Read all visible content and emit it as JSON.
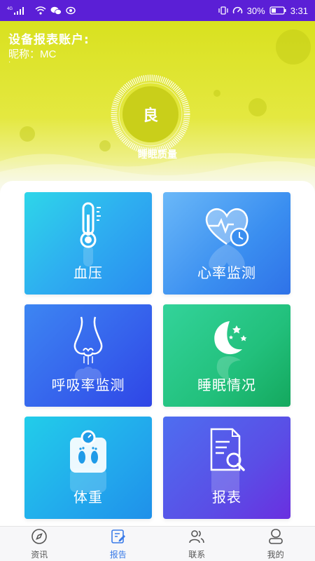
{
  "status_bar": {
    "network": "4G",
    "battery": "30%",
    "time": "3:31"
  },
  "header": {
    "account_title": "设备报表账户:",
    "nickname_label": "昵称：",
    "nickname_value": "MC",
    "dot": "·",
    "quality_value": "良",
    "quality_label": "睡眠质量"
  },
  "tiles": [
    {
      "label": "血压",
      "icon": "thermometer-icon"
    },
    {
      "label": "心率监测",
      "icon": "heart-rate-icon"
    },
    {
      "label": "呼吸率监测",
      "icon": "nose-icon"
    },
    {
      "label": "睡眠情况",
      "icon": "moon-stars-icon"
    },
    {
      "label": "体重",
      "icon": "scale-icon"
    },
    {
      "label": "报表",
      "icon": "report-search-icon"
    }
  ],
  "bottom_nav": [
    {
      "label": "资讯",
      "icon": "compass-icon",
      "active": false
    },
    {
      "label": "报告",
      "icon": "report-edit-icon",
      "active": true
    },
    {
      "label": "联系",
      "icon": "contacts-icon",
      "active": false
    },
    {
      "label": "我的",
      "icon": "profile-icon",
      "active": false
    }
  ],
  "colors": {
    "status_bar": "#5b1fd6",
    "header": "#d9e11f",
    "nav_active": "#3a7be8"
  }
}
